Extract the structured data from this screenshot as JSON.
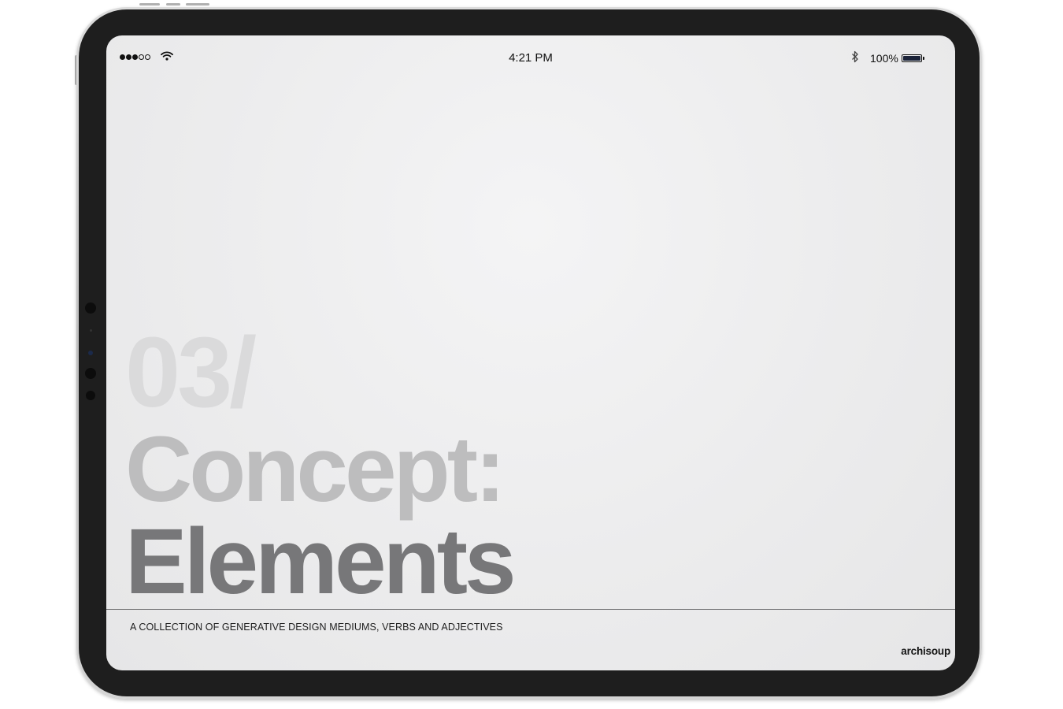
{
  "status_bar": {
    "signal_bars_filled": 3,
    "signal_bars_total": 5,
    "wifi_icon": "wifi-icon",
    "time": "4:21 PM",
    "bluetooth_icon": "bluetooth-icon",
    "battery_percent": "100%",
    "battery_level": 1.0
  },
  "content": {
    "number": "03/",
    "title_line1": "Concept:",
    "title_line2": "Elements",
    "subtitle": "A COLLECTION OF GENERATIVE DESIGN MEDIUMS, VERBS AND ADJECTIVES",
    "brand": "archisoup"
  },
  "colors": {
    "number": "#dadadb",
    "title_line1": "#bdbdbe",
    "title_line2": "#777779",
    "background": "#ececed",
    "bezel": "#1e1e1e"
  }
}
